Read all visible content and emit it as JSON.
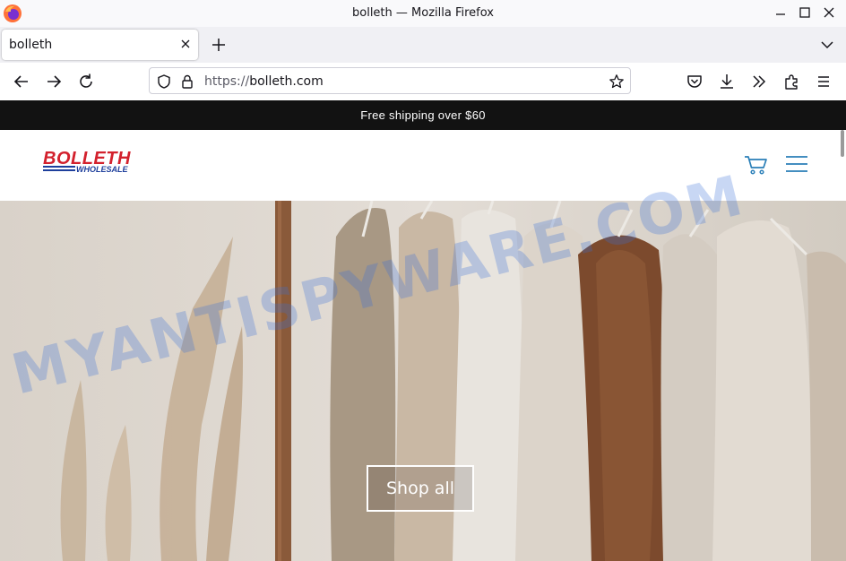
{
  "window": {
    "title": "bolleth — Mozilla Firefox"
  },
  "tabs": [
    {
      "label": "bolleth"
    }
  ],
  "urlbar": {
    "scheme": "https://",
    "host": "bolleth.com"
  },
  "announcement": {
    "text": "Free shipping over $60"
  },
  "brand": {
    "name": "BOLLETH",
    "tagline": "WHOLESALE",
    "color": "#d3212d",
    "accent": "#1e3f9c"
  },
  "hero": {
    "cta_label": "Shop all"
  },
  "watermark": {
    "text": "MYANTISPYWARE.COM"
  },
  "icons": {
    "toolbar": [
      "back-icon",
      "forward-icon",
      "reload-icon",
      "shield-icon",
      "lock-icon",
      "star-icon",
      "pocket-icon",
      "download-icon",
      "overflow-icon",
      "extensions-icon",
      "menu-icon"
    ],
    "site": [
      "cart-icon",
      "hamburger-icon"
    ]
  }
}
